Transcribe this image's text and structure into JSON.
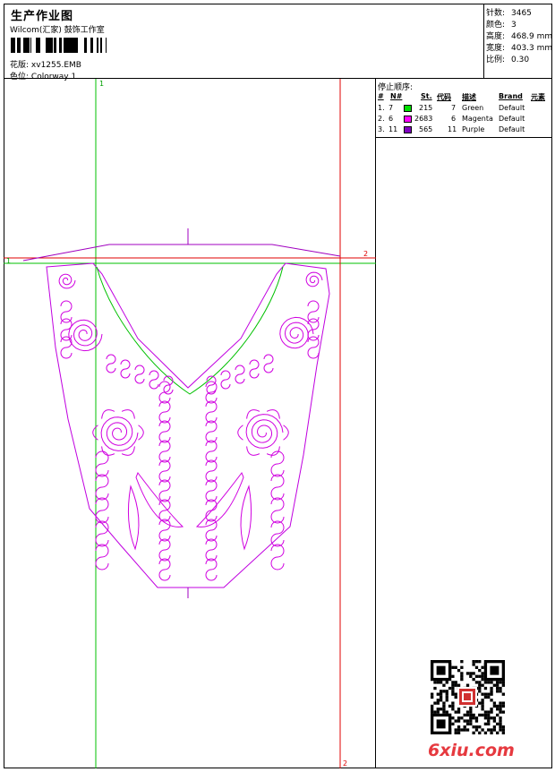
{
  "header": {
    "title": "生产作业图",
    "subtitle": "Wilcom(汇家) 鼓饰工作室",
    "design_label": "花版:",
    "design_value": "xv1255.EMB",
    "colorway_label": "色位:",
    "colorway_value": "Colorway 1"
  },
  "stats": [
    {
      "label": "针数:",
      "value": "3465"
    },
    {
      "label": "颜色:",
      "value": "3"
    },
    {
      "label": "高度:",
      "value": "468.9 mm"
    },
    {
      "label": "宽度:",
      "value": "403.3 mm"
    },
    {
      "label": "比例:",
      "value": "0.30"
    }
  ],
  "stop_sequence": {
    "title": "停止顺序:",
    "headers": {
      "idx": "#",
      "n": "N#",
      "st": "St.",
      "code": "代码",
      "desc": "描述",
      "brand": "Brand",
      "elem": "元素"
    },
    "rows": [
      {
        "idx": "1.",
        "n": "7",
        "color": "#00e000",
        "st": "215",
        "code": "7",
        "desc": "Green",
        "brand": "Default"
      },
      {
        "idx": "2.",
        "n": "6",
        "color": "#ff00ff",
        "st": "2683",
        "code": "6",
        "desc": "Magenta",
        "brand": "Default"
      },
      {
        "idx": "3.",
        "n": "11",
        "color": "#8000c0",
        "st": "565",
        "code": "11",
        "desc": "Purple",
        "brand": "Default"
      }
    ]
  },
  "guides": {
    "green_label_top": "1",
    "green_label_left": "1",
    "red_label_right": "2",
    "red_label_bottom": "2",
    "green_color": "#00c000",
    "red_color": "#e00000"
  },
  "watermark": {
    "site": "6xiu.com"
  }
}
